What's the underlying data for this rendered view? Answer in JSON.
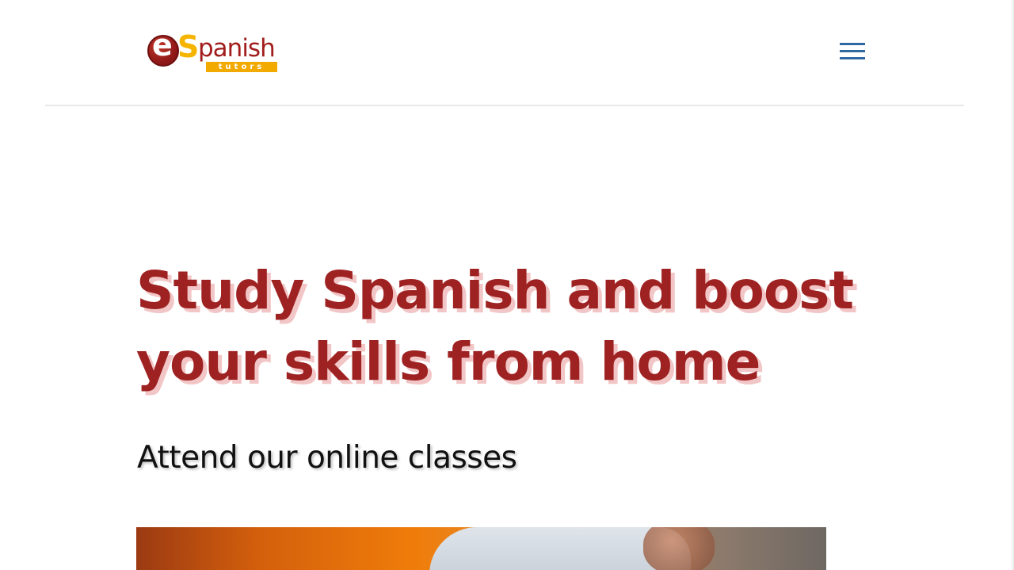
{
  "logo": {
    "e": "e",
    "s": "S",
    "word": "panish",
    "sub": "tutors",
    "colors": {
      "circle": "#8b1616",
      "s": "#f5b400",
      "word": "#a21d1d",
      "sub_bg": "#f2a900"
    }
  },
  "nav": {
    "menu_icon": "hamburger-menu-icon",
    "menu_color": "#2e6aa1"
  },
  "hero": {
    "headline": "Study Spanish and boost your skills from home",
    "headline_color": "#9f2222",
    "subheadline": "Attend our online classes",
    "image_desc_icon": "tutor-photo"
  }
}
